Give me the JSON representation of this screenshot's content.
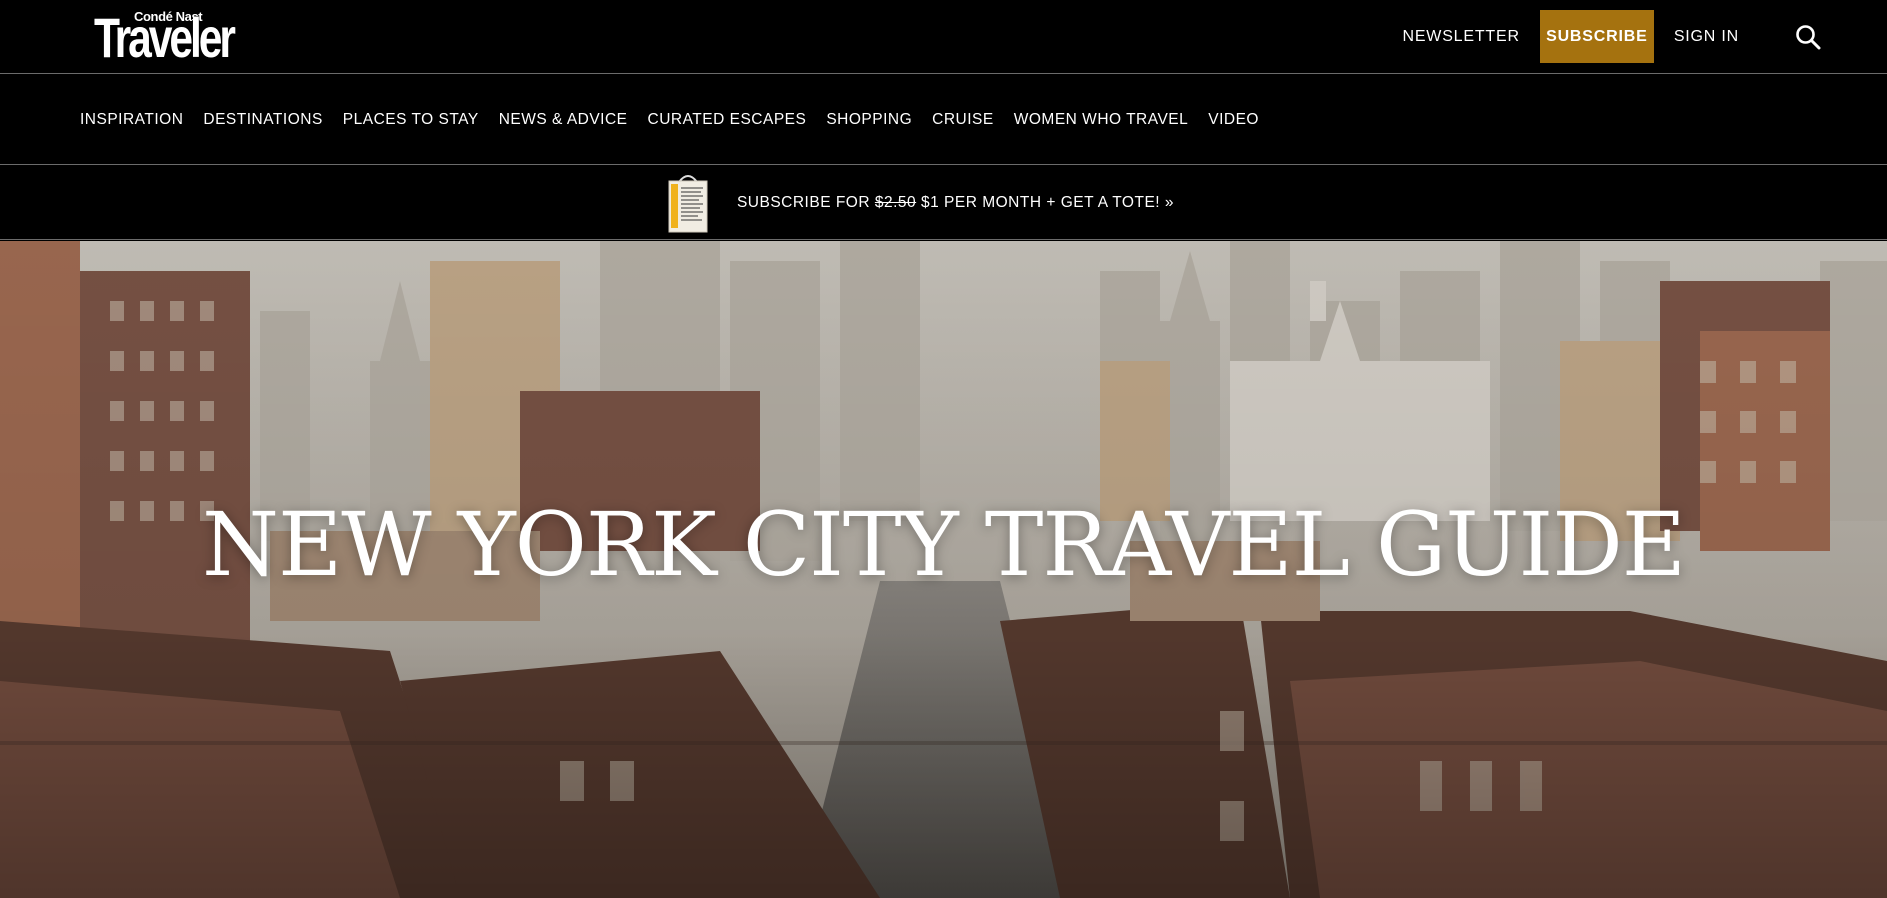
{
  "header": {
    "logo_small": "Condé Nast",
    "logo_big": "Traveler",
    "newsletter": "NEWSLETTER",
    "subscribe": "SUBSCRIBE",
    "sign_in": "SIGN IN",
    "search_icon": "search-icon",
    "accent_color": "#a5720f"
  },
  "nav": {
    "items": [
      "INSPIRATION",
      "DESTINATIONS",
      "PLACES TO STAY",
      "NEWS & ADVICE",
      "CURATED ESCAPES",
      "SHOPPING",
      "CRUISE",
      "WOMEN WHO TRAVEL",
      "VIDEO"
    ]
  },
  "promo": {
    "prefix": "SUBSCRIBE FOR ",
    "old_price": "$2.50",
    "suffix": " $1 PER MONTH + GET A TOTE! »",
    "image_icon": "tote-bag-image"
  },
  "hero": {
    "title": "NEW YORK CITY TRAVEL GUIDE",
    "image": "new-york-city-street-photo"
  }
}
